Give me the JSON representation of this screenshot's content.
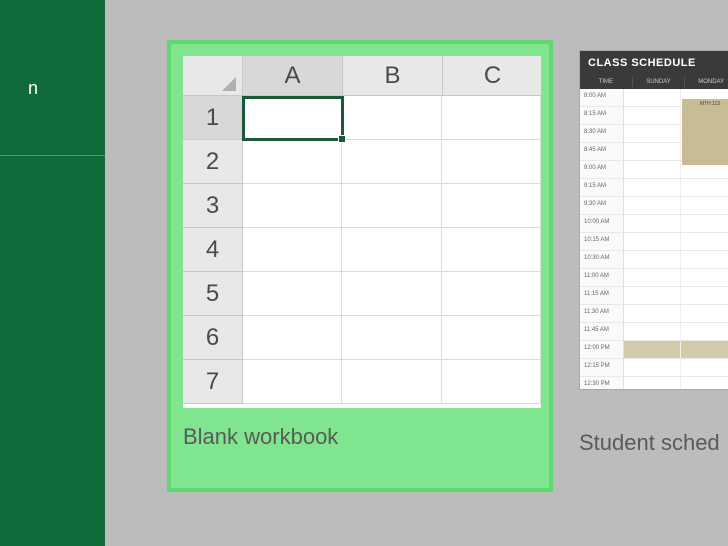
{
  "sidebar": {
    "partial_text": "n"
  },
  "templates": {
    "blank": {
      "label": "Blank workbook",
      "columns": [
        "A",
        "B",
        "C"
      ],
      "rows": [
        "1",
        "2",
        "3",
        "4",
        "5",
        "6",
        "7"
      ],
      "active_cell": "A1"
    },
    "student_schedule": {
      "label": "Student sched",
      "title": "CLASS SCHEDULE",
      "day_headers": [
        "TIME",
        "SUNDAY",
        "MONDAY"
      ],
      "times": [
        "8:00 AM",
        "8:15 AM",
        "8:30 AM",
        "8:45 AM",
        "9:00 AM",
        "9:15 AM",
        "9:30 AM",
        "10:00 AM",
        "10:15 AM",
        "10:30 AM",
        "11:00 AM",
        "11:15 AM",
        "11:30 AM",
        "11:45 AM",
        "12:00 PM",
        "12:15 PM",
        "12:30 PM"
      ],
      "event_label": "MTH 113"
    }
  },
  "colors": {
    "sidebar": "#0f6b3a",
    "highlight": "#7fe68f",
    "cell_border": "#1a5a36"
  }
}
